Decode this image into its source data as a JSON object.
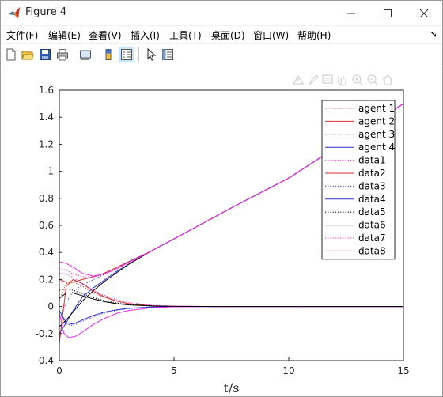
{
  "window": {
    "title": "Figure 4",
    "controls": [
      "minimize",
      "maximize",
      "close"
    ]
  },
  "menu": [
    {
      "label": "文件(F)"
    },
    {
      "label": "编辑(E)"
    },
    {
      "label": "查看(V)"
    },
    {
      "label": "插入(I)"
    },
    {
      "label": "工具(T)"
    },
    {
      "label": "桌面(D)"
    },
    {
      "label": "窗口(W)"
    },
    {
      "label": "帮助(H)"
    }
  ],
  "toolbar": {
    "icons": [
      "new-figure-icon",
      "open-file-icon",
      "save-icon",
      "print-icon",
      "link-plot-icon",
      "colorbar-icon",
      "legend-icon",
      "edit-plot-icon",
      "property-inspector-icon"
    ]
  },
  "axes_toolbar": {
    "icons": [
      "export-icon",
      "brush-icon",
      "datatip-icon",
      "pan-icon",
      "zoom-in-icon",
      "zoom-out-icon",
      "home-icon"
    ]
  },
  "colors": {
    "red": "#d92f2f",
    "blue": "#2f2fd6",
    "black": "#000000",
    "magenta": "#ee2bee"
  },
  "chart_data": {
    "type": "line",
    "xlabel": "t/s",
    "ylabel": "",
    "xlim": [
      0,
      15
    ],
    "ylim": [
      -0.4,
      1.6
    ],
    "xticks": [
      "0",
      "5",
      "10",
      "15"
    ],
    "yticks": [
      "-0.4",
      "-0.2",
      "0",
      "0.2",
      "0.4",
      "0.6",
      "0.8",
      "1",
      "1.2",
      "1.4",
      "1.6"
    ],
    "grid": false,
    "legend_position": "top-right",
    "series": [
      {
        "name": "agent 1",
        "color": "#d92f2f",
        "style": "dotted",
        "x": [
          0,
          0.3,
          0.6,
          1,
          1.5,
          2,
          2.5,
          3,
          4,
          5,
          7,
          10,
          15
        ],
        "y": [
          0.05,
          0.17,
          0.18,
          0.15,
          0.1,
          0.065,
          0.04,
          0.022,
          0.006,
          0.0015,
          0,
          0,
          0
        ]
      },
      {
        "name": "agent 2",
        "color": "#d92f2f",
        "style": "solid",
        "x": [
          0,
          0.3,
          0.6,
          1,
          1.5,
          2,
          2.5,
          3,
          4,
          5,
          7,
          10,
          15
        ],
        "y": [
          -0.27,
          0.15,
          0.2,
          0.17,
          0.11,
          0.07,
          0.04,
          0.022,
          0.006,
          0.0015,
          0,
          0,
          0
        ]
      },
      {
        "name": "agent 3",
        "color": "#2f2fd6",
        "style": "dotted",
        "x": [
          0,
          0.3,
          0.6,
          1,
          1.5,
          2,
          2.5,
          3,
          4,
          5,
          7,
          10,
          15
        ],
        "y": [
          -0.05,
          -0.13,
          -0.14,
          -0.11,
          -0.075,
          -0.047,
          -0.028,
          -0.016,
          -0.005,
          -0.001,
          0,
          0,
          0
        ]
      },
      {
        "name": "agent 4",
        "color": "#2f2fd6",
        "style": "solid",
        "x": [
          0,
          0.3,
          0.6,
          1,
          1.5,
          2,
          2.5,
          3,
          4,
          5,
          7,
          10,
          15
        ],
        "y": [
          -0.03,
          -0.12,
          -0.13,
          -0.1,
          -0.065,
          -0.04,
          -0.024,
          -0.013,
          -0.004,
          -0.001,
          0,
          0,
          0
        ]
      },
      {
        "name": "data1",
        "color": "#ee2bee",
        "style": "dotted",
        "x": [
          0,
          0.3,
          0.6,
          1,
          1.5,
          2,
          2.5,
          3,
          4,
          5,
          7,
          10,
          15
        ],
        "y": [
          0.25,
          0.24,
          0.215,
          0.17,
          0.12,
          0.08,
          0.05,
          0.03,
          0.01,
          0.003,
          0,
          0,
          0
        ]
      },
      {
        "name": "data2",
        "color": "#d92f2f",
        "style": "solid",
        "x": [
          0,
          0.3,
          0.6,
          1,
          1.5,
          2,
          2.5,
          3,
          4,
          5,
          7.5,
          10,
          15
        ],
        "y": [
          0.2,
          0.18,
          0.18,
          0.2,
          0.22,
          0.25,
          0.29,
          0.33,
          0.41,
          0.5,
          0.73,
          0.95,
          1.5
        ]
      },
      {
        "name": "data3",
        "color": "#2f2fd6",
        "style": "dotted",
        "x": [
          0,
          0.3,
          0.6,
          1,
          1.5,
          2,
          2.5,
          3,
          4,
          5,
          7.5,
          10,
          15
        ],
        "y": [
          -0.1,
          0.03,
          0.11,
          0.16,
          0.2,
          0.24,
          0.28,
          0.33,
          0.41,
          0.5,
          0.73,
          0.95,
          1.5
        ]
      },
      {
        "name": "data4",
        "color": "#2f2fd6",
        "style": "solid",
        "x": [
          0,
          0.3,
          0.6,
          1,
          1.5,
          2,
          2.5,
          3,
          4,
          5,
          7.5,
          10,
          15
        ],
        "y": [
          -0.2,
          -0.12,
          -0.03,
          0.07,
          0.14,
          0.2,
          0.26,
          0.31,
          0.41,
          0.5,
          0.73,
          0.95,
          1.5
        ]
      },
      {
        "name": "data5",
        "color": "#000000",
        "style": "dotted",
        "x": [
          0,
          0.3,
          0.6,
          1,
          1.5,
          2,
          2.5,
          3,
          4,
          5,
          7,
          10,
          15
        ],
        "y": [
          0.12,
          0.13,
          0.12,
          0.095,
          0.065,
          0.042,
          0.026,
          0.015,
          0.005,
          0.001,
          0,
          0,
          0
        ]
      },
      {
        "name": "data6",
        "color": "#000000",
        "style": "solid",
        "x": [
          0,
          0.3,
          0.6,
          1,
          1.5,
          2,
          2.5,
          3,
          4,
          5,
          7.5,
          10,
          15
        ],
        "y": [
          -0.15,
          -0.1,
          -0.04,
          0.04,
          0.12,
          0.19,
          0.25,
          0.31,
          0.41,
          0.5,
          0.73,
          0.95,
          1.5
        ]
      },
      {
        "name": "data7",
        "color": "#ee2bee",
        "style": "dotted",
        "x": [
          0,
          0.3,
          0.6,
          1,
          1.5,
          2,
          2.5,
          3,
          4,
          5,
          7.5,
          10,
          15
        ],
        "y": [
          0.28,
          0.27,
          0.24,
          0.22,
          0.22,
          0.24,
          0.28,
          0.32,
          0.41,
          0.5,
          0.73,
          0.95,
          1.5
        ]
      },
      {
        "name": "data8",
        "color": "#ee2bee",
        "style": "solid",
        "x": [
          0,
          0.3,
          0.6,
          1,
          1.5,
          2,
          2.5,
          3,
          4,
          5,
          7.5,
          10,
          15
        ],
        "y": [
          0.33,
          0.32,
          0.29,
          0.245,
          0.225,
          0.245,
          0.28,
          0.325,
          0.41,
          0.5,
          0.73,
          0.95,
          1.5
        ]
      },
      {
        "name": "",
        "color": "#ee2bee",
        "style": "solid",
        "x": [
          0,
          0.2,
          0.4,
          0.7,
          1,
          1.5,
          2,
          2.5,
          3,
          4,
          5,
          7,
          10,
          15
        ],
        "y": [
          -0.05,
          -0.2,
          -0.23,
          -0.22,
          -0.19,
          -0.13,
          -0.085,
          -0.05,
          -0.03,
          -0.009,
          -0.002,
          0,
          0,
          0
        ]
      },
      {
        "name": "",
        "color": "#000000",
        "style": "solid",
        "x": [
          0,
          0.3,
          0.6,
          1,
          1.5,
          2,
          2.5,
          3,
          4,
          5,
          7,
          10,
          15
        ],
        "y": [
          0.06,
          0.1,
          0.1,
          0.08,
          0.055,
          0.035,
          0.021,
          0.012,
          0.004,
          0.001,
          0,
          0,
          0
        ]
      }
    ]
  }
}
